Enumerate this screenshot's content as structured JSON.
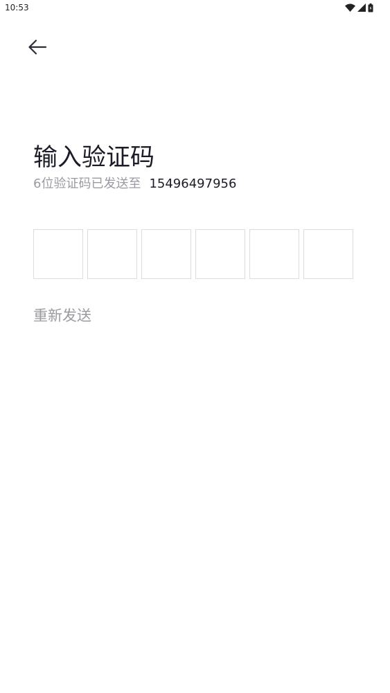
{
  "status_bar": {
    "time": "10:53",
    "icons": [
      "wifi-icon",
      "cellular-signal-icon",
      "battery-icon"
    ]
  },
  "header": {
    "back_icon": "arrow-left-icon"
  },
  "main": {
    "title": "输入验证码",
    "hint": "6位验证码已发送至",
    "phone": "15496497956",
    "code_length": 6,
    "code_digits": [
      "",
      "",
      "",
      "",
      "",
      ""
    ],
    "resend_label": "重新发送"
  },
  "colors": {
    "text_primary": "#1c1c28",
    "text_secondary": "#9a9aa2",
    "box_border": "#dcdce0",
    "background": "#ffffff"
  }
}
